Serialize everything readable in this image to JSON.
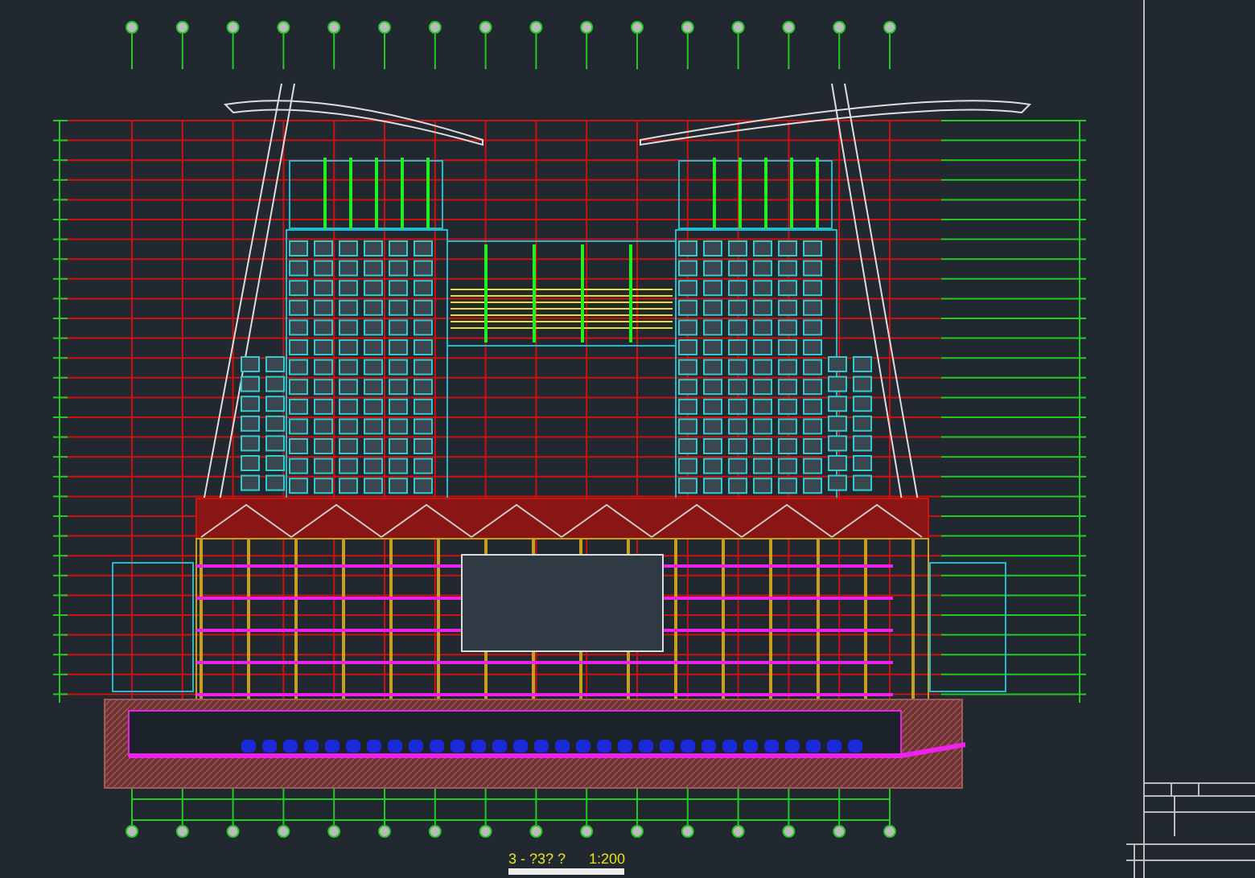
{
  "drawing": {
    "caption": {
      "title": "3 - ?3? ?",
      "scale": "1:200"
    }
  }
}
